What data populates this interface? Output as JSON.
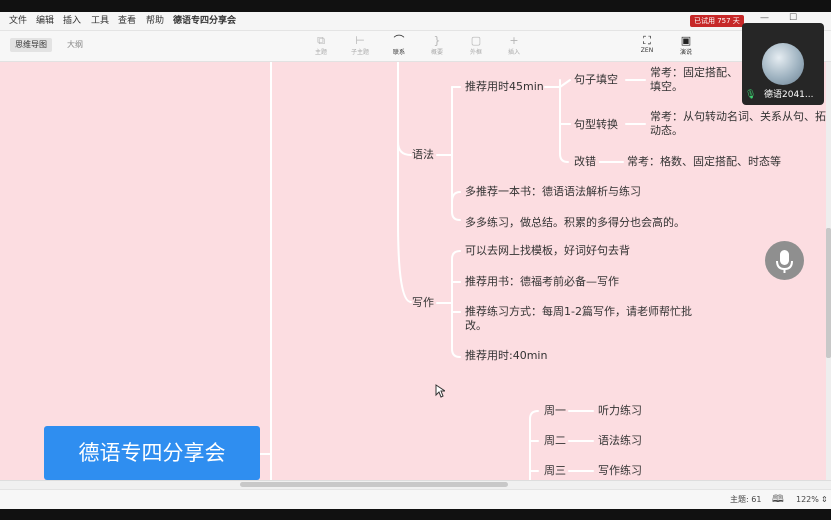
{
  "menu": {
    "items": [
      "文件",
      "编辑",
      "插入",
      "工具",
      "查看",
      "帮助"
    ],
    "doc_title": "德语专四分享会"
  },
  "trial_badge": "已试用 757 天",
  "toolbar": {
    "tabs": [
      "思维导图",
      "大纲"
    ],
    "tools": [
      {
        "label": "主题",
        "icon": "topic-icon",
        "active": false
      },
      {
        "label": "子主题",
        "icon": "subtopic-icon",
        "active": false
      },
      {
        "label": "联系",
        "icon": "relationship-icon",
        "active": true
      },
      {
        "label": "概要",
        "icon": "summary-icon",
        "active": false
      },
      {
        "label": "外框",
        "icon": "boundary-icon",
        "active": false
      },
      {
        "label": "插入",
        "icon": "plus-icon",
        "active": false
      },
      {
        "label": "ZEN",
        "icon": "zen-icon",
        "active": true
      },
      {
        "label": "演说",
        "icon": "pitch-icon",
        "active": true
      }
    ]
  },
  "mindmap": {
    "root": "德语专四分享会",
    "grammar": {
      "label": "语法",
      "time": "推荐用时45min",
      "sentence_fill": {
        "label": "句子填空",
        "note_line1": "常考：固定搭配、",
        "note_line2": "填空。"
      },
      "sentence_transform": {
        "label": "句型转换",
        "note_line1": "常考：从句转动名词、关系从句、拓",
        "note_line2": "动态。"
      },
      "correction": {
        "label": "改错",
        "note": "常考：格数、固定搭配、时态等"
      },
      "book": "多推荐一本书：德语语法解析与练习",
      "practice": "多多练习，做总结。积累的多得分也会高的。"
    },
    "writing": {
      "label": "写作",
      "items": [
        "可以去网上找模板，好词好句去背",
        "推荐用书：德福考前必备—写作",
        "推荐练习方式：每周1-2篇写作，请老师帮忙批改。",
        "推荐用时:40min"
      ]
    },
    "schedule": [
      {
        "day": "周一",
        "task": "听力练习"
      },
      {
        "day": "周二",
        "task": "语法练习"
      },
      {
        "day": "周三",
        "task": "写作练习"
      }
    ]
  },
  "video": {
    "name": "德语2041..."
  },
  "status": {
    "topics": "主题: 61",
    "zoom": "122%"
  },
  "colors": {
    "canvas": "#fcdde1",
    "root": "#2f8ef0",
    "trial": "#c62828"
  }
}
